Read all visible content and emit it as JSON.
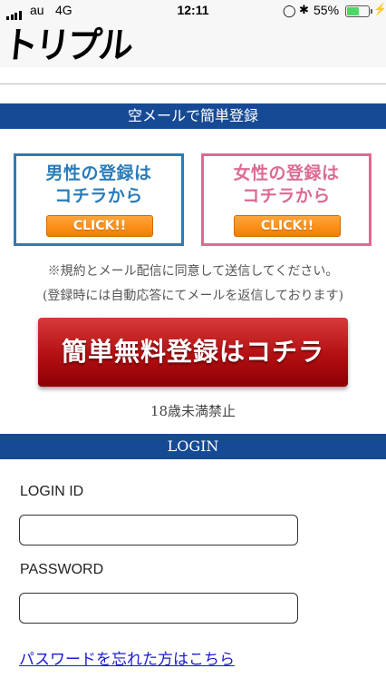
{
  "status_bar": {
    "carrier": "au",
    "network": "4G",
    "time": "12:11",
    "battery": "55%",
    "battery_level": 0.55,
    "icons": [
      "signal-icon",
      "orientation-lock-icon",
      "bluetooth-icon",
      "battery-icon",
      "charging-icon"
    ]
  },
  "header": {
    "logo": "トリプル"
  },
  "register": {
    "section_title": "空メールで簡単登録",
    "male": {
      "line1": "男性の登録は",
      "line2": "コチラから",
      "button": "CLICK!!",
      "color": "#2b7cb8"
    },
    "female": {
      "line1": "女性の登録は",
      "line2": "コチラから",
      "button": "CLICK!!",
      "color": "#dc6b93"
    },
    "note1": "※規約とメール配信に同意して送信してください。",
    "note2": "(登録時には自動応答にてメールを返信しております)",
    "free_button": "簡単無料登録はコチラ",
    "age_notice": "18歳未満禁止"
  },
  "login": {
    "section_title": "LOGIN",
    "id_label": "LOGIN ID",
    "id_value": "",
    "password_label": "PASSWORD",
    "password_value": "",
    "forgot_link": "パスワードを忘れた方はこちら"
  },
  "colors": {
    "section_bar": "#174a95",
    "link": "#1b1bd6",
    "register_button": "#b30f12",
    "click_button": "#f57e00"
  }
}
